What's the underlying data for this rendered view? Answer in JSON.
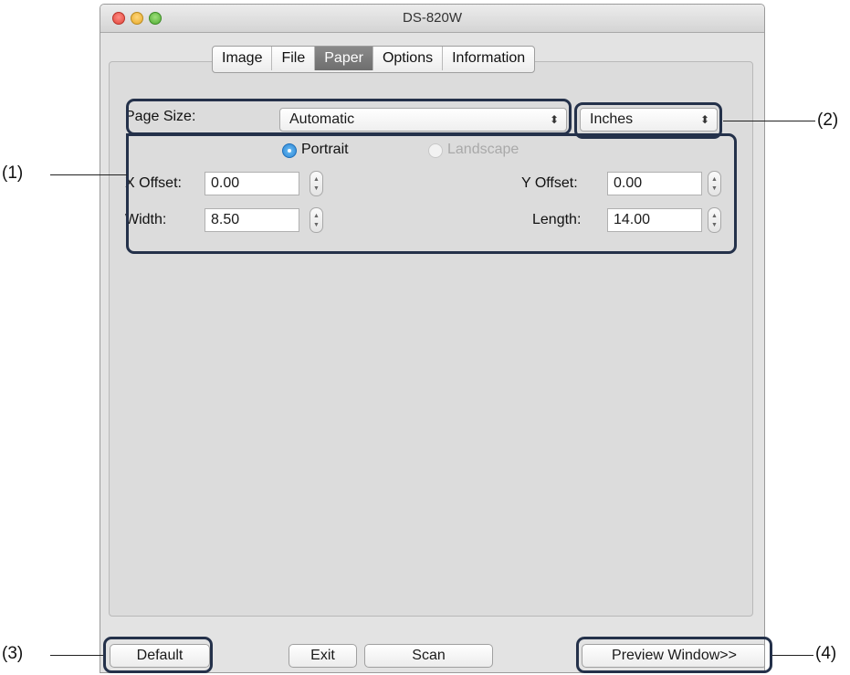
{
  "window": {
    "title": "DS-820W",
    "tabs": [
      {
        "label": "Image",
        "active": false
      },
      {
        "label": "File",
        "active": false
      },
      {
        "label": "Paper",
        "active": true
      },
      {
        "label": "Options",
        "active": false
      },
      {
        "label": "Information",
        "active": false
      }
    ]
  },
  "paper": {
    "page_size_label": "Page Size:",
    "page_size_value": "Automatic",
    "units_value": "Inches",
    "orientation": {
      "portrait": "Portrait",
      "landscape": "Landscape",
      "selected": "Portrait"
    },
    "x_offset_label": "X Offset:",
    "x_offset_value": "0.00",
    "y_offset_label": "Y Offset:",
    "y_offset_value": "0.00",
    "width_label": "Width:",
    "width_value": "8.50",
    "length_label": "Length:",
    "length_value": "14.00"
  },
  "buttons": {
    "default": "Default",
    "exit": "Exit",
    "scan": "Scan",
    "preview": "Preview Window>>"
  },
  "callouts": {
    "c1": "(1)",
    "c2": "(2)",
    "c3": "(3)",
    "c4": "(4)"
  },
  "colors": {
    "highlight": "#24314a",
    "radio_selected": "#2a83d4",
    "tab_active": "#7a7a7a"
  },
  "icons": {
    "close": "red-traffic-light",
    "minimize": "yellow-traffic-light",
    "zoom": "green-traffic-light",
    "select_arrows": "updown-chevrons",
    "stepper": "up-down-stepper"
  }
}
